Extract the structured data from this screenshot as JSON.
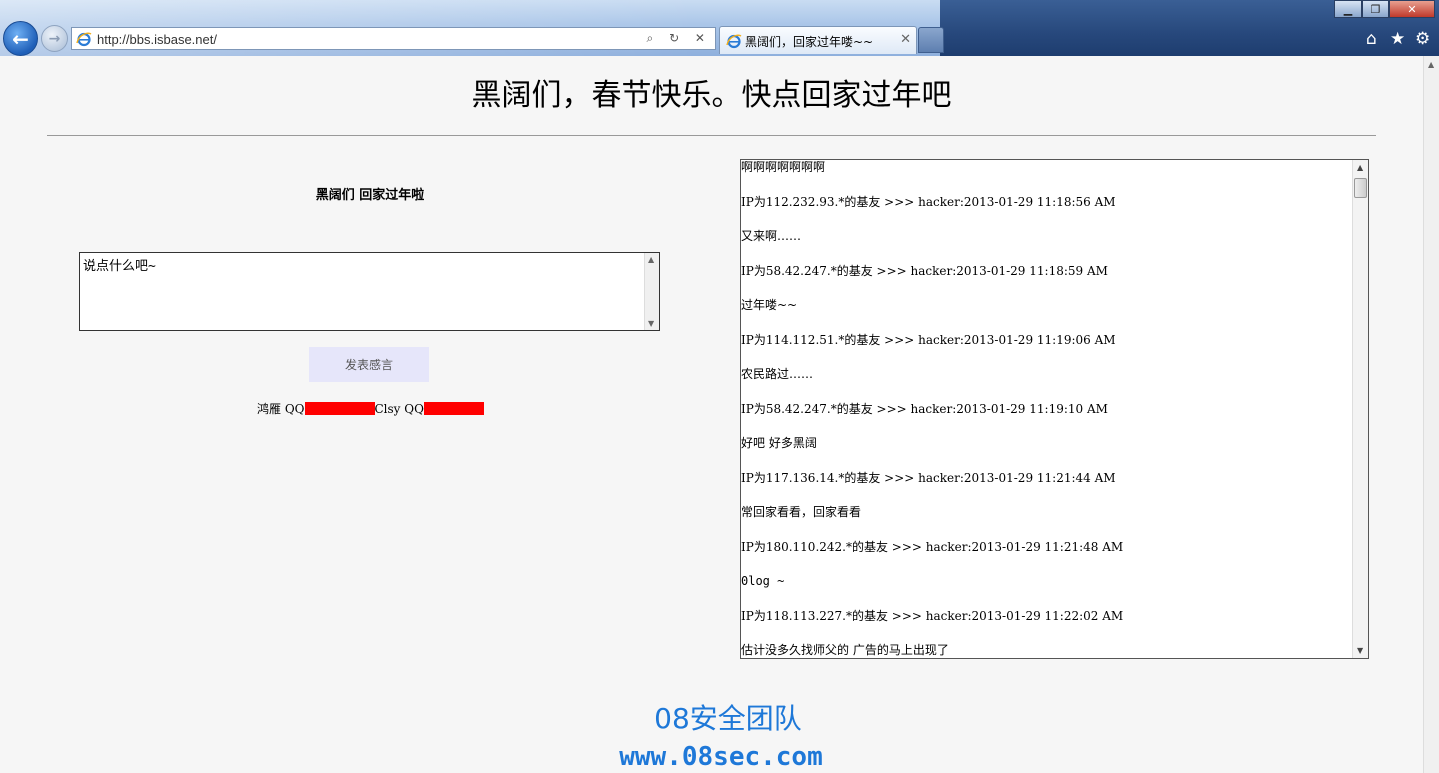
{
  "browser": {
    "address": "http://bbs.isbase.net/",
    "tab_title": "黑阔们，回家过年喽~~",
    "tab_close": "✕",
    "addr_tools": "⌕ ↻ ✕",
    "back_glyph": "←",
    "forward_glyph": "→",
    "min_glyph": "▁",
    "max_glyph": "❐",
    "close_glyph": "✕",
    "home_glyph": "⌂",
    "star_glyph": "★",
    "gear_glyph": "⚙"
  },
  "page": {
    "title": "黑阔们，春节快乐。快点回家过年吧",
    "left_heading": "黑阔们  回家过年啦",
    "message_placeholder": "说点什么吧~",
    "submit_label": "发表感言",
    "contact_prefix": "鸿雁  QQ",
    "contact_mid": "Clsy QQ"
  },
  "messages": [
    "啊啊啊啊啊啊啊",
    "IP为112.232.93.*的基友  >>> hacker:2013-01-29 11:18:56 AM",
    "又来啊……",
    "IP为58.42.247.*的基友  >>> hacker:2013-01-29 11:18:59 AM",
    "过年喽~~",
    "IP为114.112.51.*的基友  >>> hacker:2013-01-29 11:19:06 AM",
    "农民路过……",
    "IP为58.42.247.*的基友  >>> hacker:2013-01-29 11:19:10 AM",
    "好吧  好多黑阔",
    "IP为117.136.14.*的基友  >>> hacker:2013-01-29 11:21:44 AM",
    "常回家看看，回家看看",
    "IP为180.110.242.*的基友  >>> hacker:2013-01-29 11:21:48 AM",
    "0log ~",
    "IP为118.113.227.*的基友  >>> hacker:2013-01-29 11:22:02 AM",
    "估计没多久找师父的  广告的马上出现了"
  ],
  "watermark": {
    "team": "08安全团队",
    "url": "www.08sec.com"
  },
  "colors": {
    "accent": "#1e78d8",
    "redaction": "#ff0000",
    "button_bg": "#e6e6fa"
  }
}
